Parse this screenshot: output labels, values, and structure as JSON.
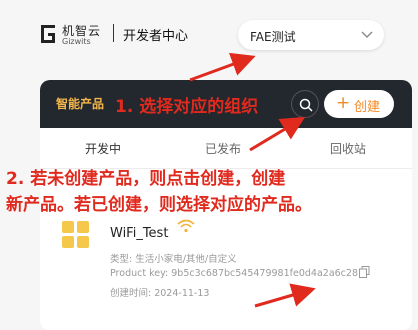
{
  "header": {
    "logo_cn": "机智云",
    "logo_en": "Gizwits",
    "dev_center": "开发者中心",
    "org_select": {
      "value": "FAE测试"
    }
  },
  "panel": {
    "title": "智能产品",
    "create_label": "创建",
    "tabs": [
      {
        "label": "开发中"
      },
      {
        "label": "已发布"
      },
      {
        "label": "回收站"
      }
    ]
  },
  "product": {
    "name": "WiFi_Test",
    "type": "类型: 生活小家电/其他/自定义",
    "product_key": "Product key: 9b5c3c687bc545479981fe0d4a2a6c28",
    "created": "创建时间: 2024-11-13"
  },
  "annotations": {
    "step1": "1. 选择对应的组织",
    "step2_line1": "2. 若未创建产品，则点击创建，创建",
    "step2_line2": "新产品。若已创建，则选择对应的产品。"
  },
  "colors": {
    "annotation_red": "#e02a1e",
    "accent_orange": "#f08a24",
    "panel_dark": "#23272e",
    "title_gold": "#f2b64b"
  }
}
